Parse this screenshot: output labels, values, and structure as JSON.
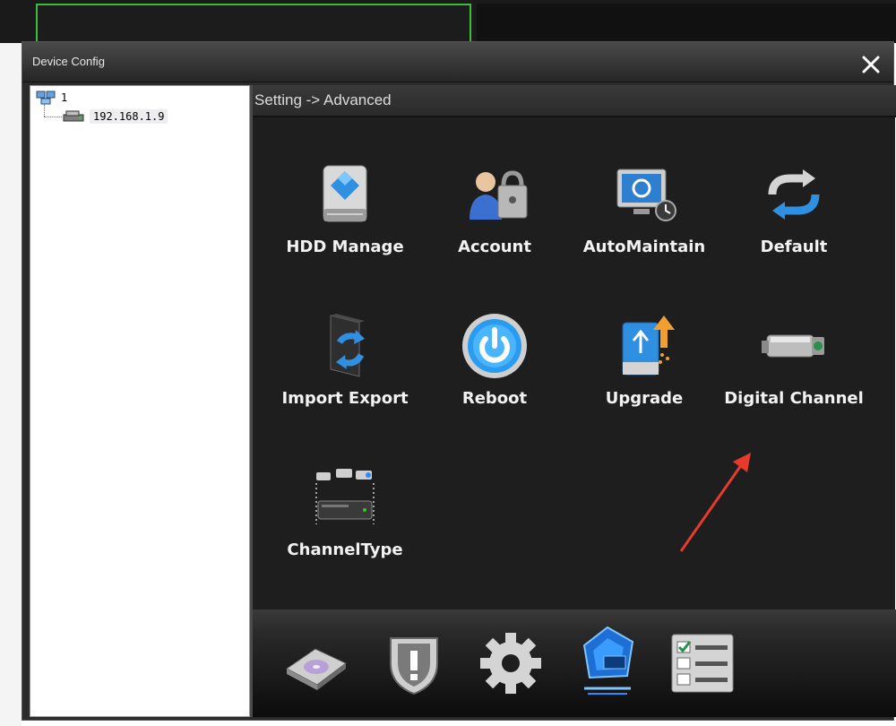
{
  "window": {
    "title": "Device Config",
    "close_icon": "close-icon"
  },
  "tree": {
    "root_label": "1",
    "device_label": "192.168.1.9"
  },
  "breadcrumb": "Setting -> Advanced",
  "grid": [
    {
      "label": "HDD Manage",
      "icon": "hdd-icon"
    },
    {
      "label": "Account",
      "icon": "account-icon"
    },
    {
      "label": "AutoMaintain",
      "icon": "automaintain-icon"
    },
    {
      "label": "Default",
      "icon": "default-icon"
    },
    {
      "label": "Import Export",
      "icon": "import-export-icon"
    },
    {
      "label": "Reboot",
      "icon": "reboot-icon"
    },
    {
      "label": "Upgrade",
      "icon": "upgrade-icon"
    },
    {
      "label": "Digital Channel",
      "icon": "camera-icon"
    },
    {
      "label": "ChannelType",
      "icon": "channel-type-icon"
    }
  ],
  "dock": [
    {
      "icon": "disk-icon"
    },
    {
      "icon": "shield-alert-icon"
    },
    {
      "icon": "gear-icon"
    },
    {
      "icon": "advanced-icon",
      "active": true
    },
    {
      "icon": "checklist-icon"
    }
  ],
  "colors": {
    "accent_green": "#3bbf3b",
    "annotation_red": "#e53b2c",
    "active_glow": "#2a8cff"
  }
}
